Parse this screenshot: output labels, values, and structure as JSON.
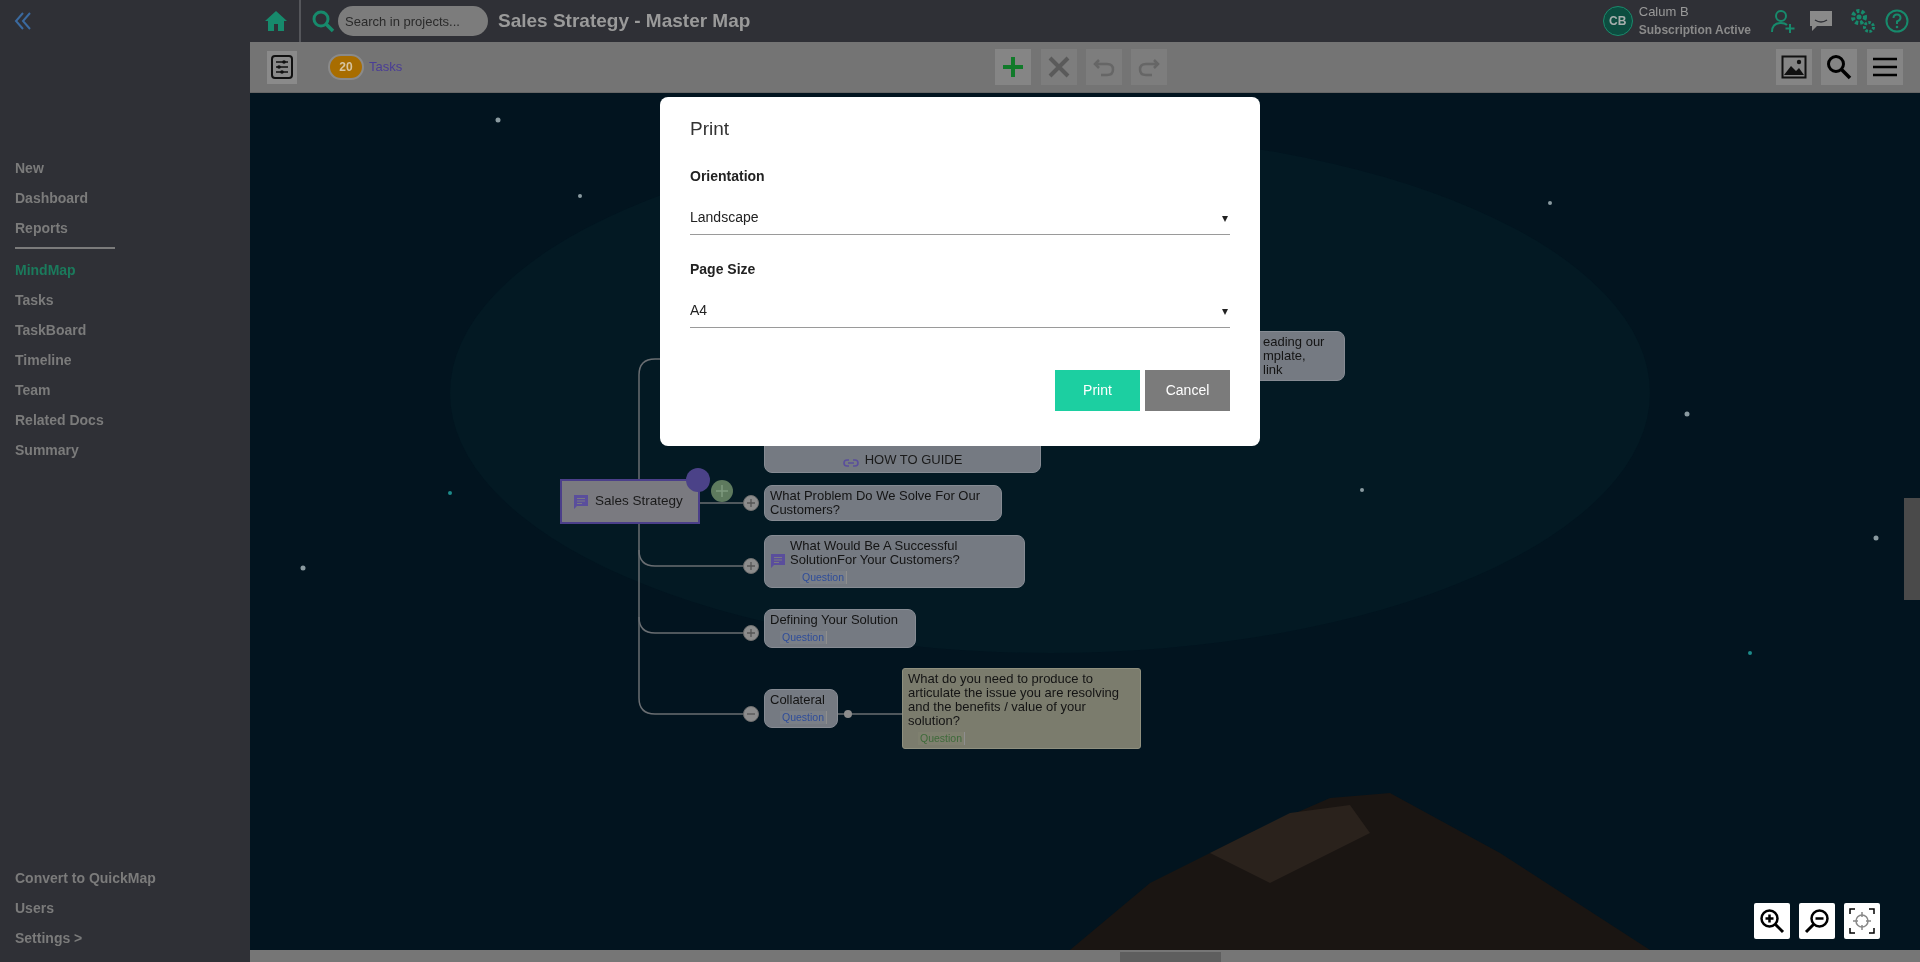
{
  "sidebar": {
    "nav_groups": [
      [
        {
          "label": "New",
          "selected": false
        },
        {
          "label": "Dashboard",
          "selected": false
        },
        {
          "label": "Reports",
          "selected": false
        }
      ],
      [
        {
          "label": "MindMap",
          "selected": true
        },
        {
          "label": "Tasks",
          "selected": false
        },
        {
          "label": "TaskBoard",
          "selected": false
        },
        {
          "label": "Timeline",
          "selected": false
        },
        {
          "label": "Team",
          "selected": false
        },
        {
          "label": "Related Docs",
          "selected": false
        },
        {
          "label": "Summary",
          "selected": false
        }
      ]
    ],
    "bottom_items": [
      "Convert to QuickMap",
      "Users",
      "Settings >"
    ]
  },
  "top_bar": {
    "search": {
      "placeholder": "Search in projects..."
    },
    "title": "Sales Strategy - Master Map",
    "user": {
      "initials": "CB",
      "name": "Calum B",
      "status": "Subscription Active"
    }
  },
  "toolbar": {
    "tasks_count": "20",
    "tasks_label": "Tasks"
  },
  "mind_map": {
    "root": {
      "label": "Sales Strategy",
      "comment": true
    },
    "nodes": [
      {
        "kind": "question",
        "text": "eading our\nmplate,\nlink"
      },
      {
        "kind": "link",
        "text": "HOW TO GUIDE"
      },
      {
        "kind": "question",
        "text": "What Problem Do We Solve For Our Customers?",
        "comment": false,
        "expanded": false
      },
      {
        "kind": "question",
        "text": "What Would Be A Successful SolutionFor Your Customers?",
        "tag": "Question",
        "comment": true,
        "expanded": false
      },
      {
        "kind": "question",
        "text": "Defining Your Solution",
        "tag": "Question",
        "comment": false,
        "expanded": false
      },
      {
        "kind": "question",
        "text": "Collateral",
        "tag": "Question",
        "comment": false,
        "expanded": true
      },
      {
        "kind": "note",
        "text": "What do you need to produce to articulate the issue you are resolving and the benefits / value of your solution?",
        "tag": "Question"
      }
    ]
  },
  "dialog": {
    "title": "Print",
    "fields": [
      {
        "label": "Orientation",
        "value": "Landscape",
        "arrow": "▾"
      },
      {
        "label": "Page Size",
        "value": "A4",
        "arrow": "▾"
      }
    ],
    "buttons": [
      {
        "label": "Print",
        "kind": "primary"
      },
      {
        "label": "Cancel",
        "kind": "secondary"
      }
    ]
  }
}
